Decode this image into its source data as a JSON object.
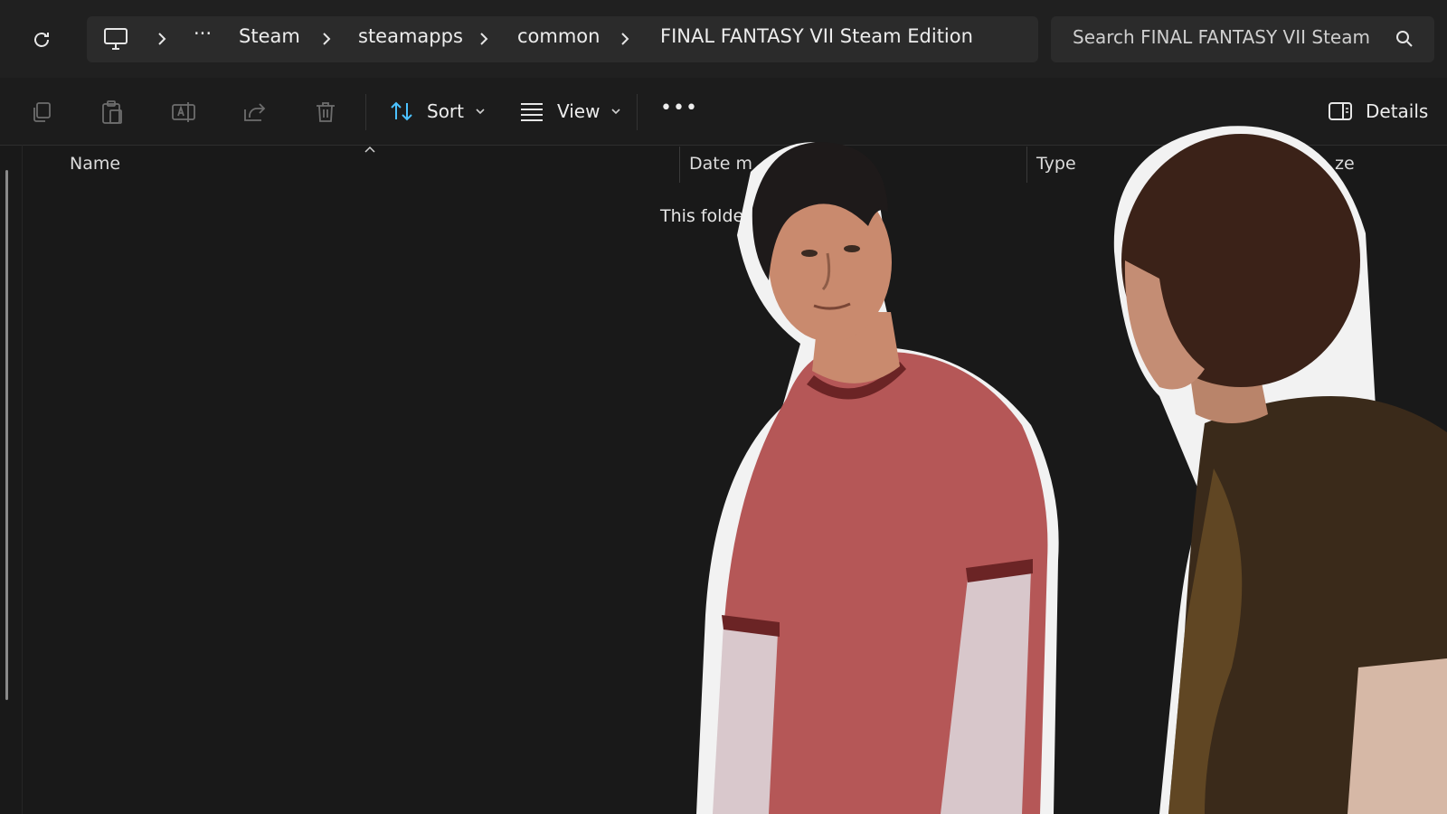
{
  "breadcrumb": {
    "overflow": "···",
    "items": [
      "Steam",
      "steamapps",
      "common",
      "FINAL FANTASY VII Steam Edition"
    ]
  },
  "search": {
    "placeholder": "Search FINAL FANTASY VII Steam Edition"
  },
  "commandbar": {
    "sort_label": "Sort",
    "view_label": "View",
    "more_label": "•••",
    "details_label": "Details"
  },
  "columns": {
    "name": "Name",
    "date": "Date m",
    "type": "Type",
    "size": "ze"
  },
  "content": {
    "empty_message": "This folder"
  },
  "colors": {
    "background": "#191919",
    "toolbar": "#202020",
    "field": "#2b2b2b",
    "accent": "#4cc2ff"
  },
  "icons": [
    "refresh-icon",
    "monitor-icon",
    "chevron-right-icon",
    "copy-icon",
    "paste-icon",
    "rename-icon",
    "share-icon",
    "delete-icon",
    "sort-icon",
    "view-icon",
    "details-pane-icon",
    "search-icon"
  ]
}
